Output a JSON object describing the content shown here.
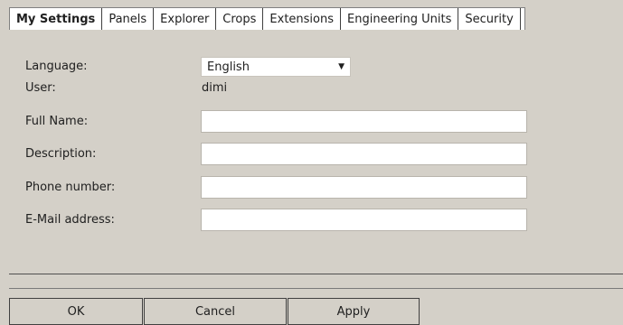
{
  "tabs": [
    {
      "label": "My Settings",
      "active": true
    },
    {
      "label": "Panels"
    },
    {
      "label": "Explorer"
    },
    {
      "label": "Crops"
    },
    {
      "label": "Extensions"
    },
    {
      "label": "Engineering Units"
    },
    {
      "label": "Security"
    }
  ],
  "form": {
    "language_label": "Language:",
    "language_value": "English",
    "user_label": "User:",
    "user_value": "dimi",
    "full_name_label": "Full Name:",
    "full_name_value": "",
    "description_label": "Description:",
    "description_value": "",
    "phone_label": "Phone number:",
    "phone_value": "",
    "email_label": "E-Mail address:",
    "email_value": ""
  },
  "buttons": {
    "ok": "OK",
    "cancel": "Cancel",
    "apply": "Apply"
  }
}
